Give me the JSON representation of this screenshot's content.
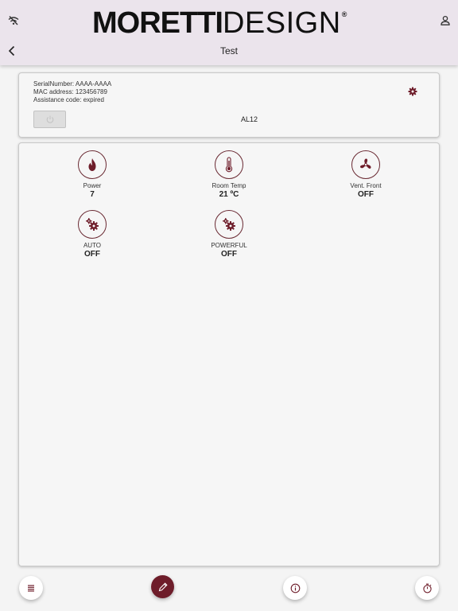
{
  "header": {
    "brand_bold": "MORETTI",
    "brand_light": "DESIGN",
    "brand_reg": "®",
    "title": "Test"
  },
  "device": {
    "serial": "SerialNumber: AAAA-AAAA",
    "mac": "MAC address: 123456789",
    "assistance": "Assistance code: expired",
    "code": "AL12"
  },
  "tiles": [
    {
      "icon": "flame-icon",
      "label": "Power",
      "value": "7"
    },
    {
      "icon": "thermometer-icon",
      "label": "Room Temp",
      "value": "21 ºC"
    },
    {
      "icon": "fan-icon",
      "label": "Vent. Front",
      "value": "OFF"
    },
    {
      "icon": "gears-icon",
      "label": "AUTO",
      "value": "OFF"
    },
    {
      "icon": "gears-icon",
      "label": "POWERFUL",
      "value": "OFF"
    }
  ],
  "bottom_bar": [
    "menu-icon",
    "edit-icon",
    "info-icon",
    "timer-icon"
  ],
  "colors": {
    "accent": "#6e1d2a",
    "header_bg": "#ebe4ec",
    "page_bg": "#f4f4f4",
    "card_bg": "#f6f6f6"
  }
}
